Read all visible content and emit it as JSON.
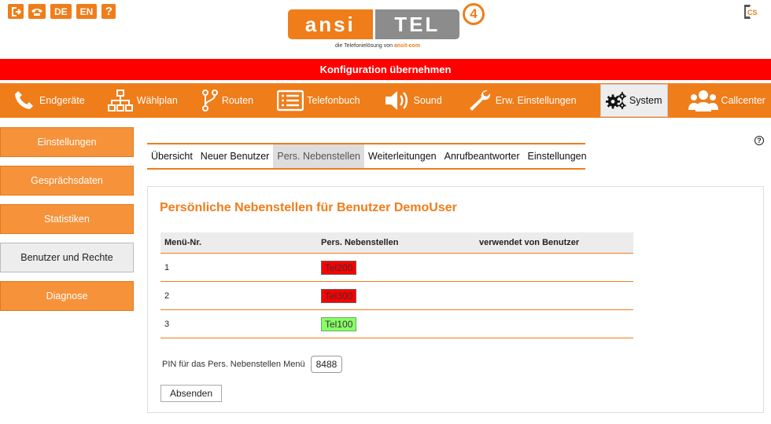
{
  "header": {
    "lang_de": "DE",
    "lang_en": "EN",
    "help_glyph": "?",
    "logo_left": "ansi",
    "logo_right": "TEL",
    "logo_version": "4",
    "logo_tagline_prefix": "die Telefonielösung von",
    "logo_tagline_brand": "ansit-com",
    "cs_logo": "CS"
  },
  "banner": {
    "label": "Konfiguration übernehmen"
  },
  "nav": {
    "items": [
      {
        "label": "Endgeräte",
        "icon": "phone-icon"
      },
      {
        "label": "Wählplan",
        "icon": "sitemap-icon"
      },
      {
        "label": "Routen",
        "icon": "route-icon"
      },
      {
        "label": "Telefonbuch",
        "icon": "list-icon"
      },
      {
        "label": "Sound",
        "icon": "speaker-icon"
      },
      {
        "label": "Erw. Einstellungen",
        "icon": "wrench-icon"
      },
      {
        "label": "System",
        "icon": "gears-icon"
      },
      {
        "label": "Callcenter",
        "icon": "users-icon"
      }
    ],
    "active": "System"
  },
  "sidebar": {
    "items": [
      {
        "label": "Einstellungen"
      },
      {
        "label": "Gesprächsdaten"
      },
      {
        "label": "Statistiken"
      },
      {
        "label": "Benutzer und Rechte"
      },
      {
        "label": "Diagnose"
      }
    ],
    "active": "Benutzer und Rechte"
  },
  "help_icon": "?",
  "tabs": {
    "items": [
      {
        "label": "Übersicht"
      },
      {
        "label": "Neuer Benutzer"
      },
      {
        "label": "Pers. Nebenstellen"
      },
      {
        "label": "Weiterleitungen"
      },
      {
        "label": "Anrufbeantworter"
      },
      {
        "label": "Einstellungen"
      }
    ],
    "active": "Pers. Nebenstellen"
  },
  "panel": {
    "title": "Persönliche Nebenstellen für Benutzer DemoUser",
    "table": {
      "columns": [
        "Menü-Nr.",
        "Pers. Nebenstellen",
        "verwendet von Benutzer"
      ],
      "rows": [
        {
          "nr": "1",
          "ext": "Tel200",
          "status": "red",
          "used_by": ""
        },
        {
          "nr": "2",
          "ext": "Tel300",
          "status": "red",
          "used_by": ""
        },
        {
          "nr": "3",
          "ext": "Tel100",
          "status": "green",
          "used_by": ""
        }
      ]
    },
    "pin_label": "PIN für das Pers. Nebenstellen Menü",
    "pin_value": "8488",
    "submit_label": "Absenden"
  },
  "colors": {
    "accent": "#ef7d1a",
    "banner": "#ff0000",
    "status_red": "#ff0000",
    "status_green": "#88ff66"
  }
}
